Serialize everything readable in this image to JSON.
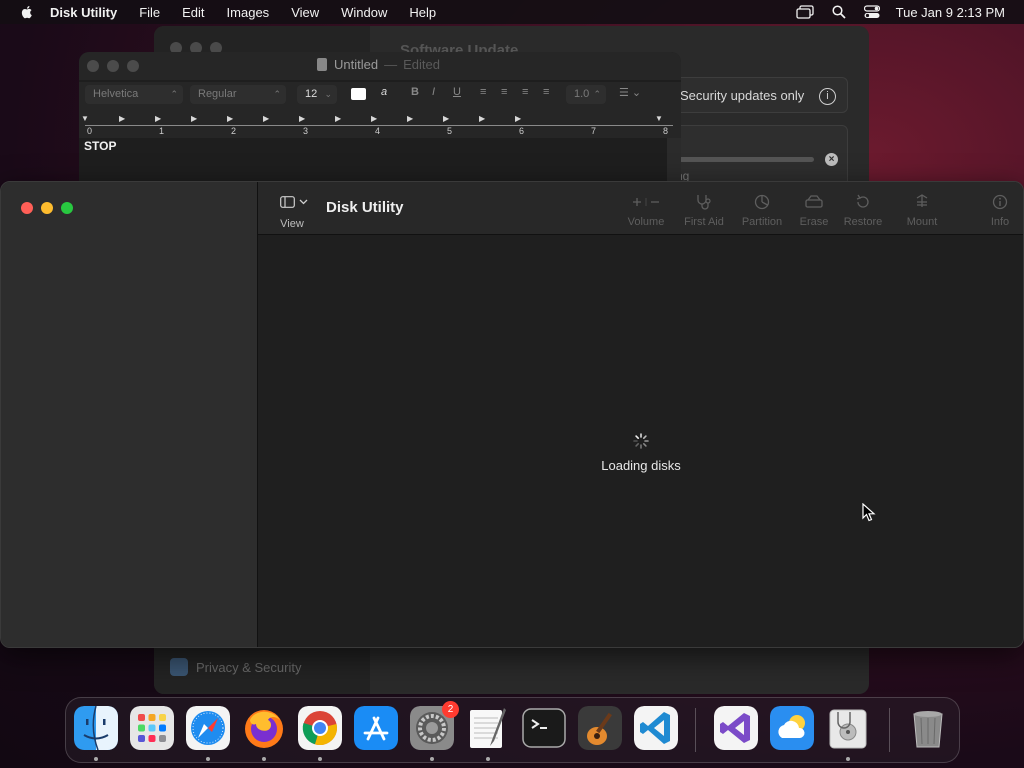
{
  "menubar": {
    "app_name": "Disk Utility",
    "items": [
      "File",
      "Edit",
      "Images",
      "View",
      "Window",
      "Help"
    ],
    "clock": "Tue Jan 9  2:13 PM"
  },
  "software_update": {
    "title": "Software Update",
    "security_label": "Security updates only",
    "search_fragment": "ng",
    "privacy_label": "Privacy & Security"
  },
  "textedit": {
    "title": "Untitled",
    "separator": "—",
    "edited": "Edited",
    "font_family": "Helvetica",
    "font_style": "Regular",
    "font_size": "12",
    "bold": "B",
    "italic": "I",
    "underline": "U",
    "line_spacing": "1.0",
    "highlight_glyph": "a",
    "ruler_numbers": [
      "0",
      "1",
      "2",
      "3",
      "4",
      "5",
      "6",
      "7",
      "8"
    ],
    "content": "STOP"
  },
  "disk_utility": {
    "view_label": "View",
    "title": "Disk Utility",
    "toolbar": [
      {
        "label": "Volume",
        "icon": "plus-minus-icon"
      },
      {
        "label": "First Aid",
        "icon": "stethoscope-icon"
      },
      {
        "label": "Partition",
        "icon": "pie-chart-icon"
      },
      {
        "label": "Erase",
        "icon": "eraser-icon"
      },
      {
        "label": "Restore",
        "icon": "restore-icon"
      },
      {
        "label": "Mount",
        "icon": "eject-icon"
      },
      {
        "label": "Info",
        "icon": "info-icon"
      }
    ],
    "loading_text": "Loading disks"
  },
  "dock": {
    "apps": [
      {
        "name": "Finder",
        "icon": "finder-icon",
        "running": true
      },
      {
        "name": "Launchpad",
        "icon": "launchpad-icon",
        "running": false
      },
      {
        "name": "Safari",
        "icon": "safari-icon",
        "running": true
      },
      {
        "name": "Firefox",
        "icon": "firefox-icon",
        "running": true
      },
      {
        "name": "Chrome",
        "icon": "chrome-icon",
        "running": true
      },
      {
        "name": "App Store",
        "icon": "app-store-icon",
        "running": false
      },
      {
        "name": "System Settings",
        "icon": "system-settings-icon",
        "running": true,
        "badge": "2"
      },
      {
        "name": "TextEdit",
        "icon": "textedit-icon",
        "running": true
      },
      {
        "name": "Terminal",
        "icon": "terminal-icon",
        "running": false
      },
      {
        "name": "GarageBand",
        "icon": "garageband-icon",
        "running": false
      },
      {
        "name": "Visual Studio Code",
        "icon": "vscode-icon",
        "running": false
      },
      {
        "name": "Visual Studio",
        "icon": "visual-studio-icon",
        "running": false
      },
      {
        "name": "Weather",
        "icon": "weather-icon",
        "running": false
      },
      {
        "name": "Disk Utility",
        "icon": "disk-utility-icon",
        "running": true
      },
      {
        "name": "Trash",
        "icon": "trash-icon",
        "running": false
      }
    ]
  },
  "colors": {
    "close": "#ff5f57",
    "minimize": "#febc2e",
    "zoom": "#28c840",
    "badge": "#ff3b30"
  }
}
